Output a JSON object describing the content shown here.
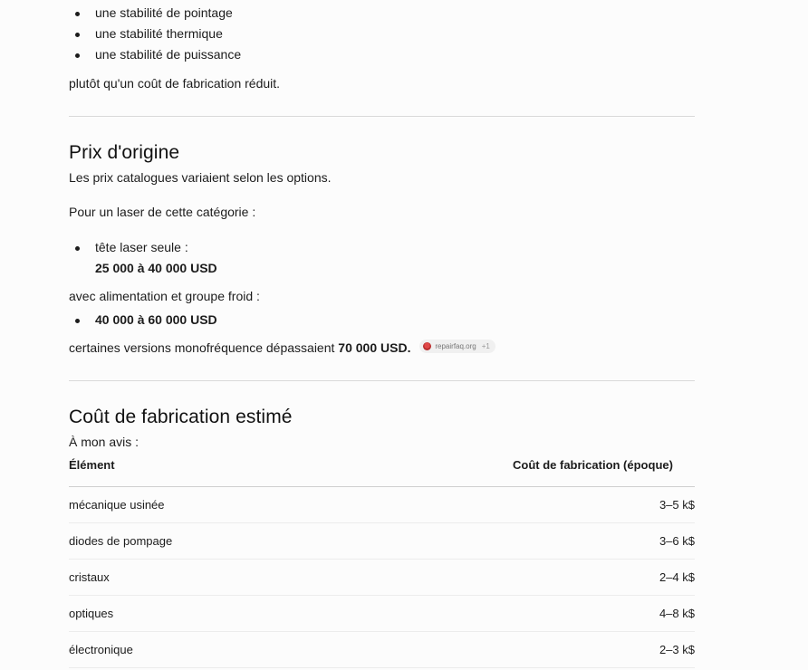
{
  "top_list": {
    "items": [
      "une stabilité de pointage",
      "une stabilité thermique",
      "une stabilité de puissance"
    ],
    "closing": "plutôt qu'un coût de fabrication réduit."
  },
  "prix_section": {
    "heading": "Prix d'origine",
    "intro": "Les prix catalogues variaient selon les options.",
    "category_intro": "Pour un laser de cette catégorie :",
    "head_only_label": "tête laser seule :",
    "head_only_price": "25 000 à 40 000 USD",
    "with_power_label": "avec alimentation et groupe froid :",
    "with_power_price": "40 000 à 60 000 USD",
    "mono_text": "certaines versions monofréquence dépassaient",
    "mono_price": "70 000 USD",
    "mono_period": ".",
    "source_chip": {
      "label": "repairfaq.org",
      "count": "+1",
      "icon": "site-favicon-icon"
    }
  },
  "cout_section": {
    "heading": "Coût de fabrication estimé",
    "intro": "À mon avis :",
    "table": {
      "headers": [
        "Élément",
        "Coût de fabrication (époque)"
      ],
      "rows": [
        {
          "element": "mécanique usinée",
          "cost": "3–5 k$"
        },
        {
          "element": "diodes de pompage",
          "cost": "3–6 k$"
        },
        {
          "element": "cristaux",
          "cost": "2–4 k$"
        },
        {
          "element": "optiques",
          "cost": "4–8 k$"
        },
        {
          "element": "électronique",
          "cost": "2–3 k$"
        }
      ]
    }
  }
}
